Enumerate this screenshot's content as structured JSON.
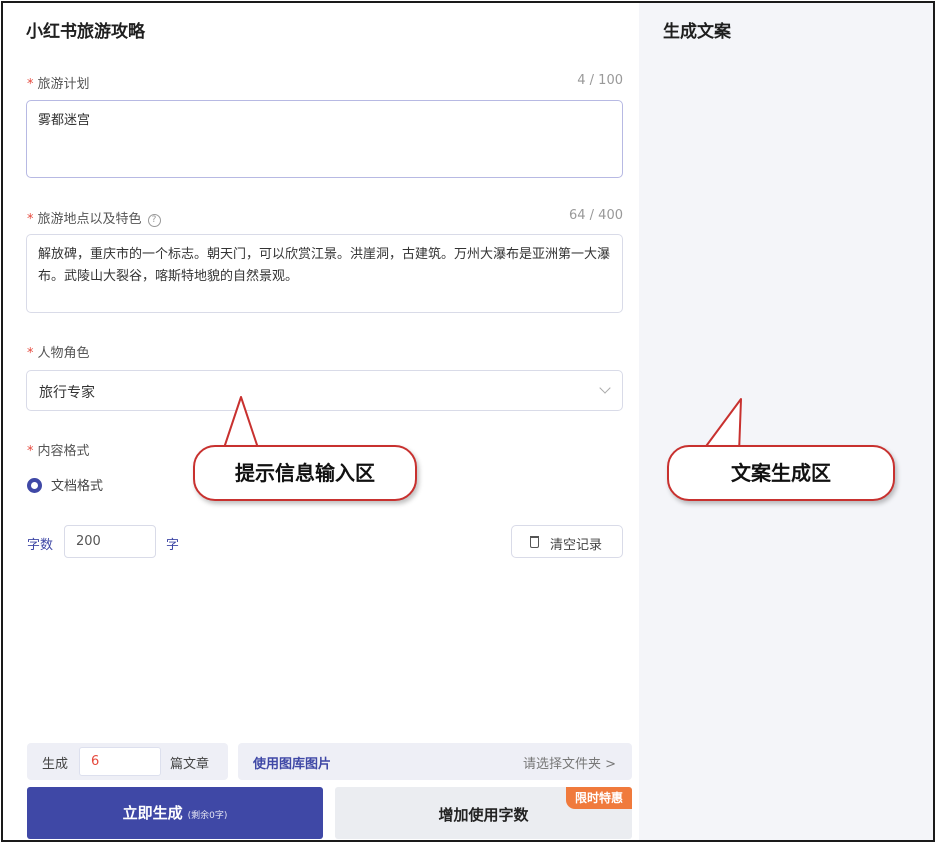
{
  "app_title": "小红书旅游攻略",
  "output_panel": {
    "title": "生成文案"
  },
  "form": {
    "required_mark": "*",
    "plan": {
      "label": "旅游计划",
      "counter": "4 / 100",
      "value": "雾都迷宫"
    },
    "places": {
      "label": "旅游地点以及特色",
      "help_icon": "?",
      "counter": "64 / 400",
      "value": "解放碑，重庆市的一个标志。朝天门，可以欣赏江景。洪崖洞，古建筑。万州大瀑布是亚洲第一大瀑布。武陵山大裂谷，喀斯特地貌的自然景观。"
    },
    "persona": {
      "label": "人物角色",
      "value": "旅行专家"
    },
    "format": {
      "label": "内容格式",
      "option": "文档格式",
      "selected": true
    },
    "word_count": {
      "label": "字数",
      "value": "200",
      "suffix": "字"
    },
    "clear_button": "清空记录"
  },
  "callouts": {
    "left": "提示信息输入区",
    "right": "文案生成区"
  },
  "bottom": {
    "generate_label": "生成",
    "generate_count": "6",
    "generate_suffix": "篇文章",
    "gallery_label": "使用图库图片",
    "gallery_select": "请选择文件夹 >",
    "primary_button": "立即生成",
    "primary_sub": "(剩余0字)",
    "secondary_button": "增加使用字数",
    "promo_badge": "限时特惠"
  },
  "icons": {
    "help": "help-circle-icon",
    "chevron": "chevron-down-icon",
    "trash": "trash-icon",
    "radio": "radio-checked-icon"
  },
  "colors": {
    "accent": "#3f48a6",
    "required": "#e5483c",
    "promo": "#f07a3c",
    "callout_border": "#c8312f"
  }
}
